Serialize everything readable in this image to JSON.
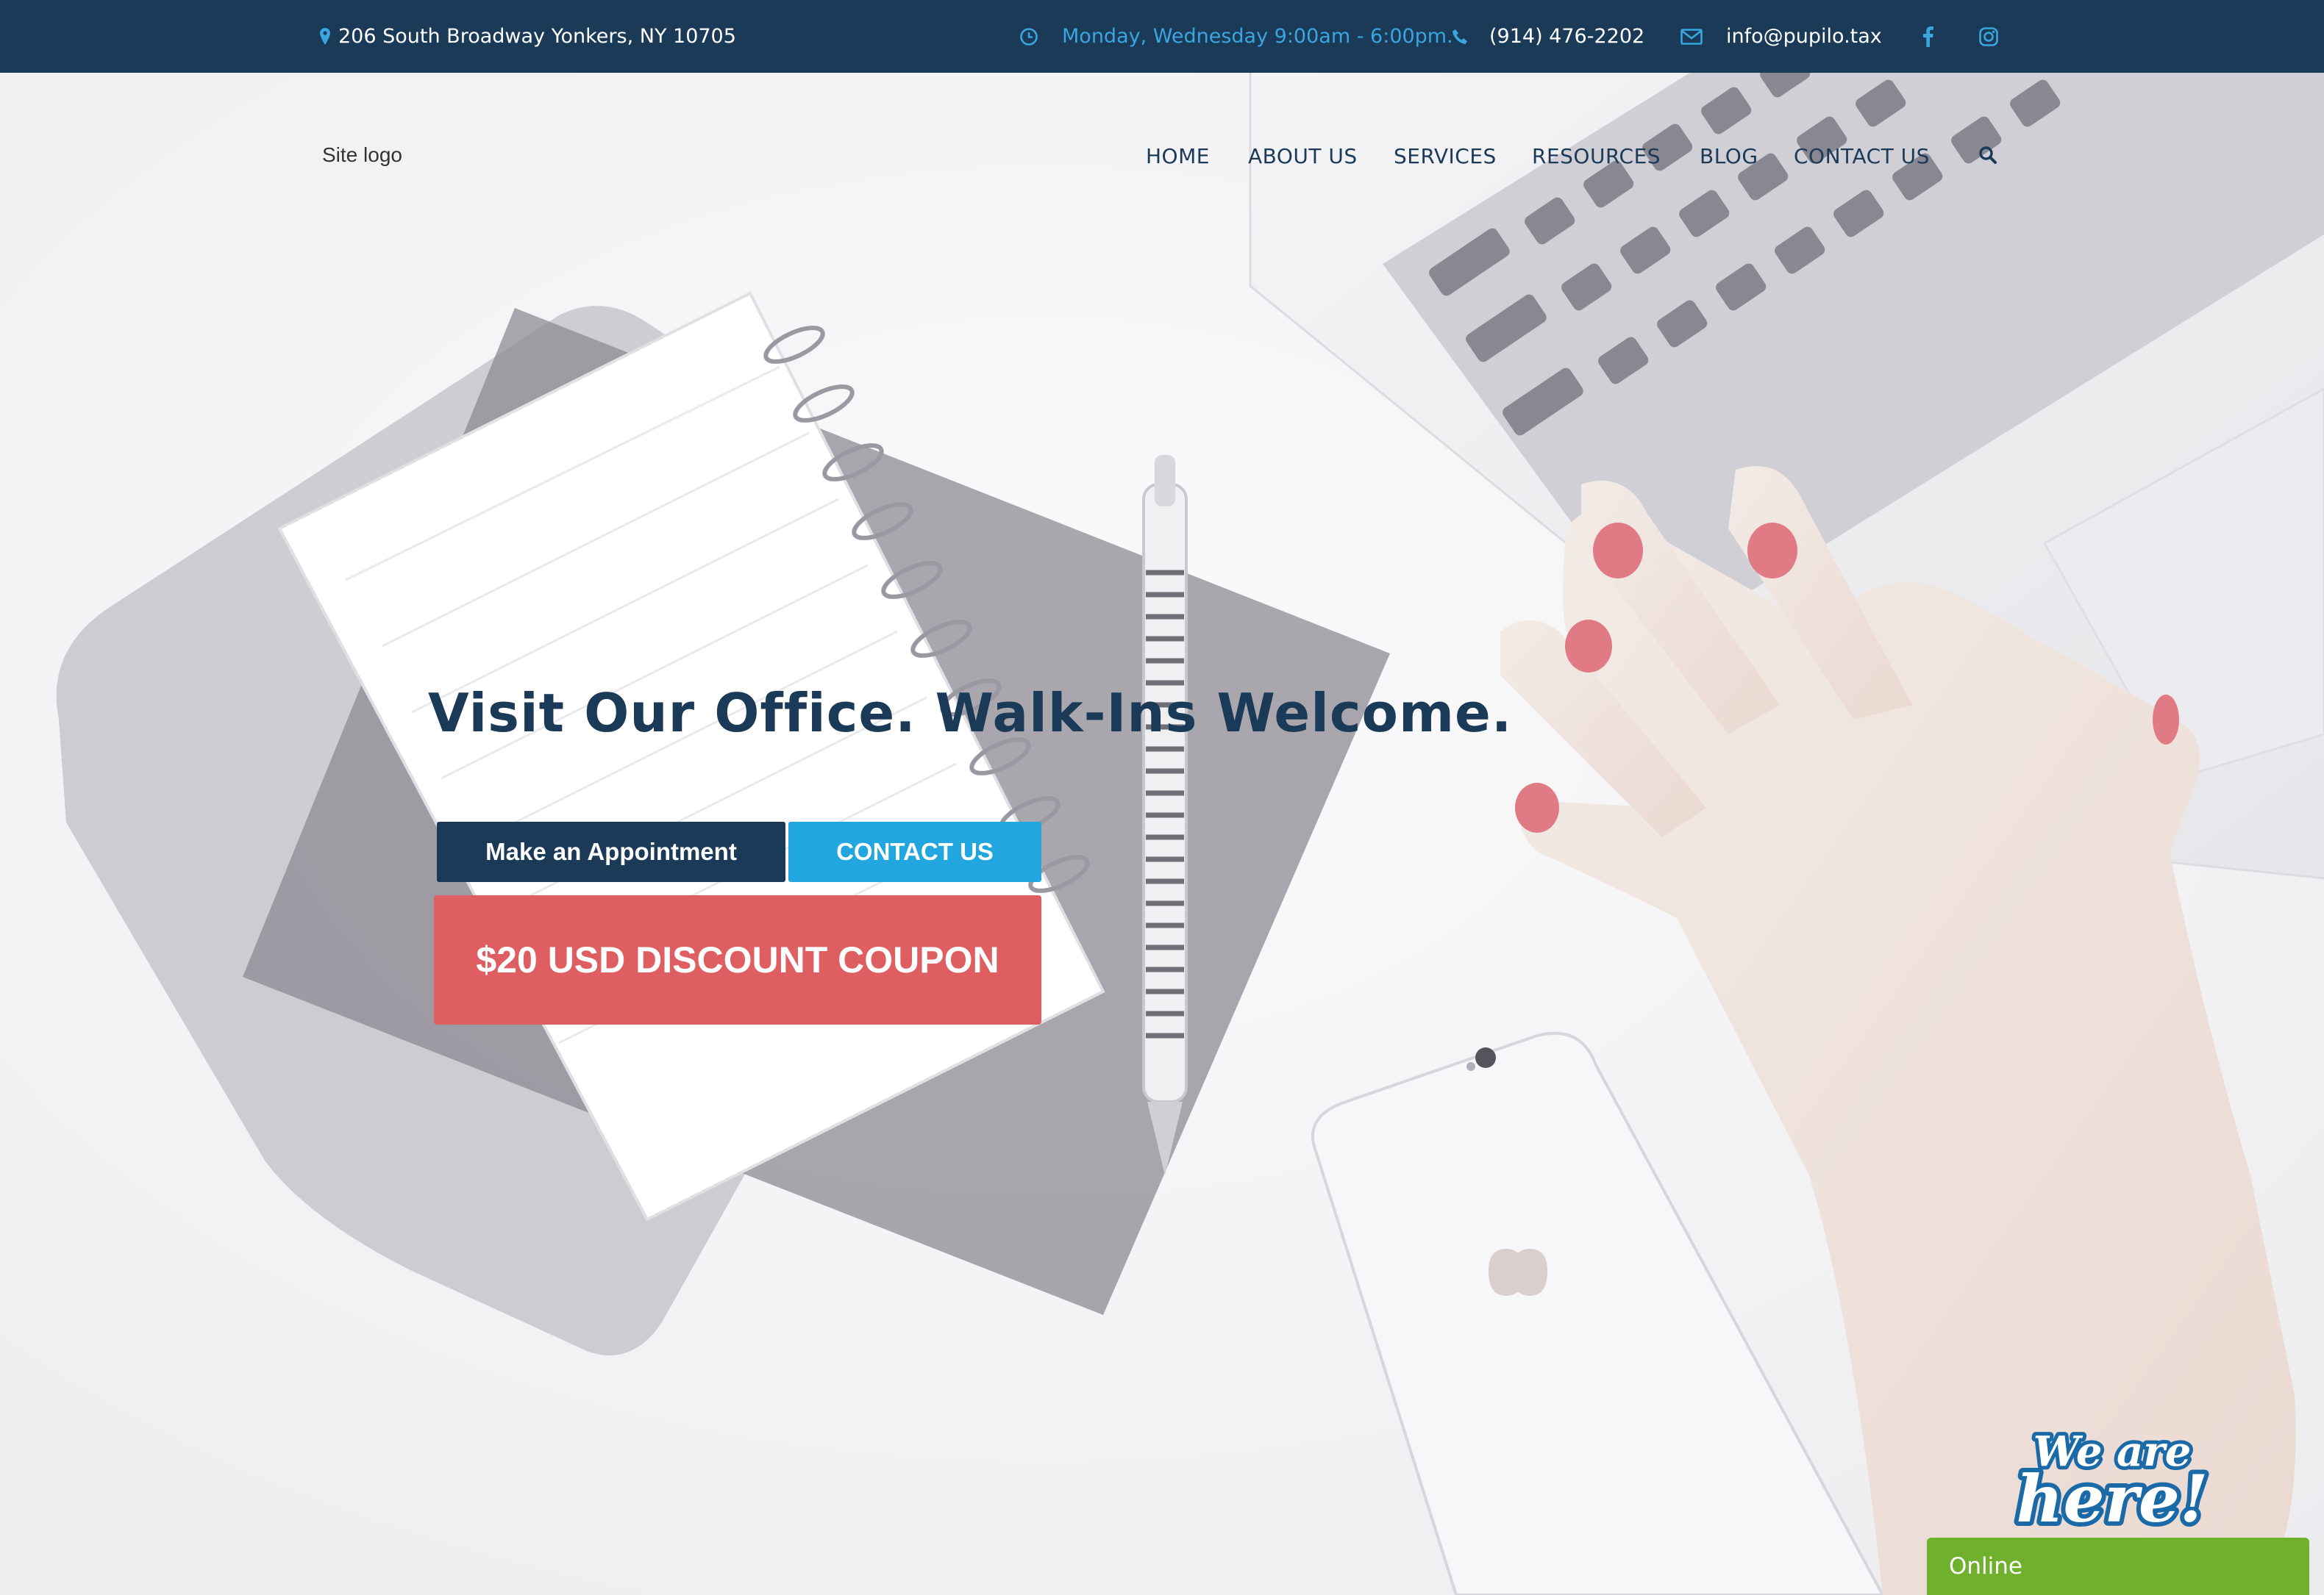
{
  "topbar": {
    "address": "206 South Broadway Yonkers, NY 10705",
    "hours": "Monday, Wednesday 9:00am - 6:00pm.",
    "phone": "(914) 476-2202",
    "email": "info@pupilo.tax",
    "social": [
      "facebook-icon",
      "instagram-icon"
    ]
  },
  "header": {
    "logo": "Site logo",
    "nav": [
      "HOME",
      "ABOUT US",
      "SERVICES",
      "RESOURCES",
      "BLOG",
      "CONTACT US"
    ]
  },
  "hero": {
    "title": "Visit Our Office. Walk-Ins Welcome.",
    "appointment_label": "Make an Appointment",
    "contact_label": "CONTACT US",
    "coupon_label": "$20 USD DISCOUNT COUPON"
  },
  "chat": {
    "badge_line1": "We are",
    "badge_line2": "here!",
    "status": "Online"
  },
  "colors": {
    "navy": "#1b3a57",
    "accent_blue": "#22a6df",
    "coupon_red": "#de5e62",
    "chat_green": "#6fb12d"
  }
}
